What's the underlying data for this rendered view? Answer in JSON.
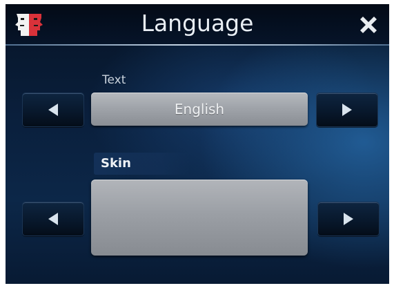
{
  "window": {
    "title": "Language",
    "app_icon": "faces-icon",
    "close_icon": "close-icon"
  },
  "text_section": {
    "label": "Text",
    "value": "English",
    "prev_icon": "arrow-left-icon",
    "next_icon": "arrow-right-icon"
  },
  "skin_section": {
    "label": "Skin",
    "value": "",
    "prev_icon": "arrow-left-icon",
    "next_icon": "arrow-right-icon"
  },
  "colors": {
    "background": "#0a1f3c",
    "title_text": "#e9eef4",
    "value_box": "#9ea2a8",
    "arrow": "#d9e4ee"
  }
}
